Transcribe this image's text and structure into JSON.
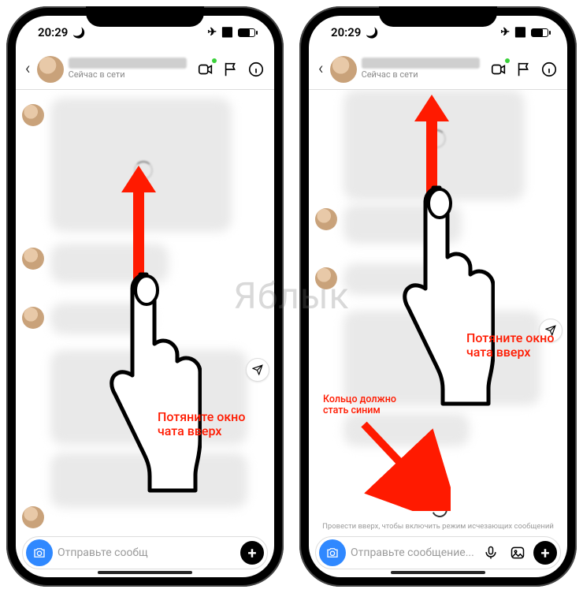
{
  "watermark": "Яблык",
  "status": {
    "time": "20:29"
  },
  "header": {
    "subtitle": "Сейчас в сети",
    "video_icon": "video-icon",
    "flag_icon": "flag-icon",
    "info_icon": "info-icon"
  },
  "input": {
    "placeholder_left": "Отправьте сообщ",
    "placeholder_right": "Отправьте сообщение..."
  },
  "annotations": {
    "pull_up": "Потяните окно\nчата вверх",
    "ring_hint": "Кольцо должно\nстать синим",
    "swipe_hint": "Провести вверх, чтобы включить режим исчезающих сообщений"
  }
}
